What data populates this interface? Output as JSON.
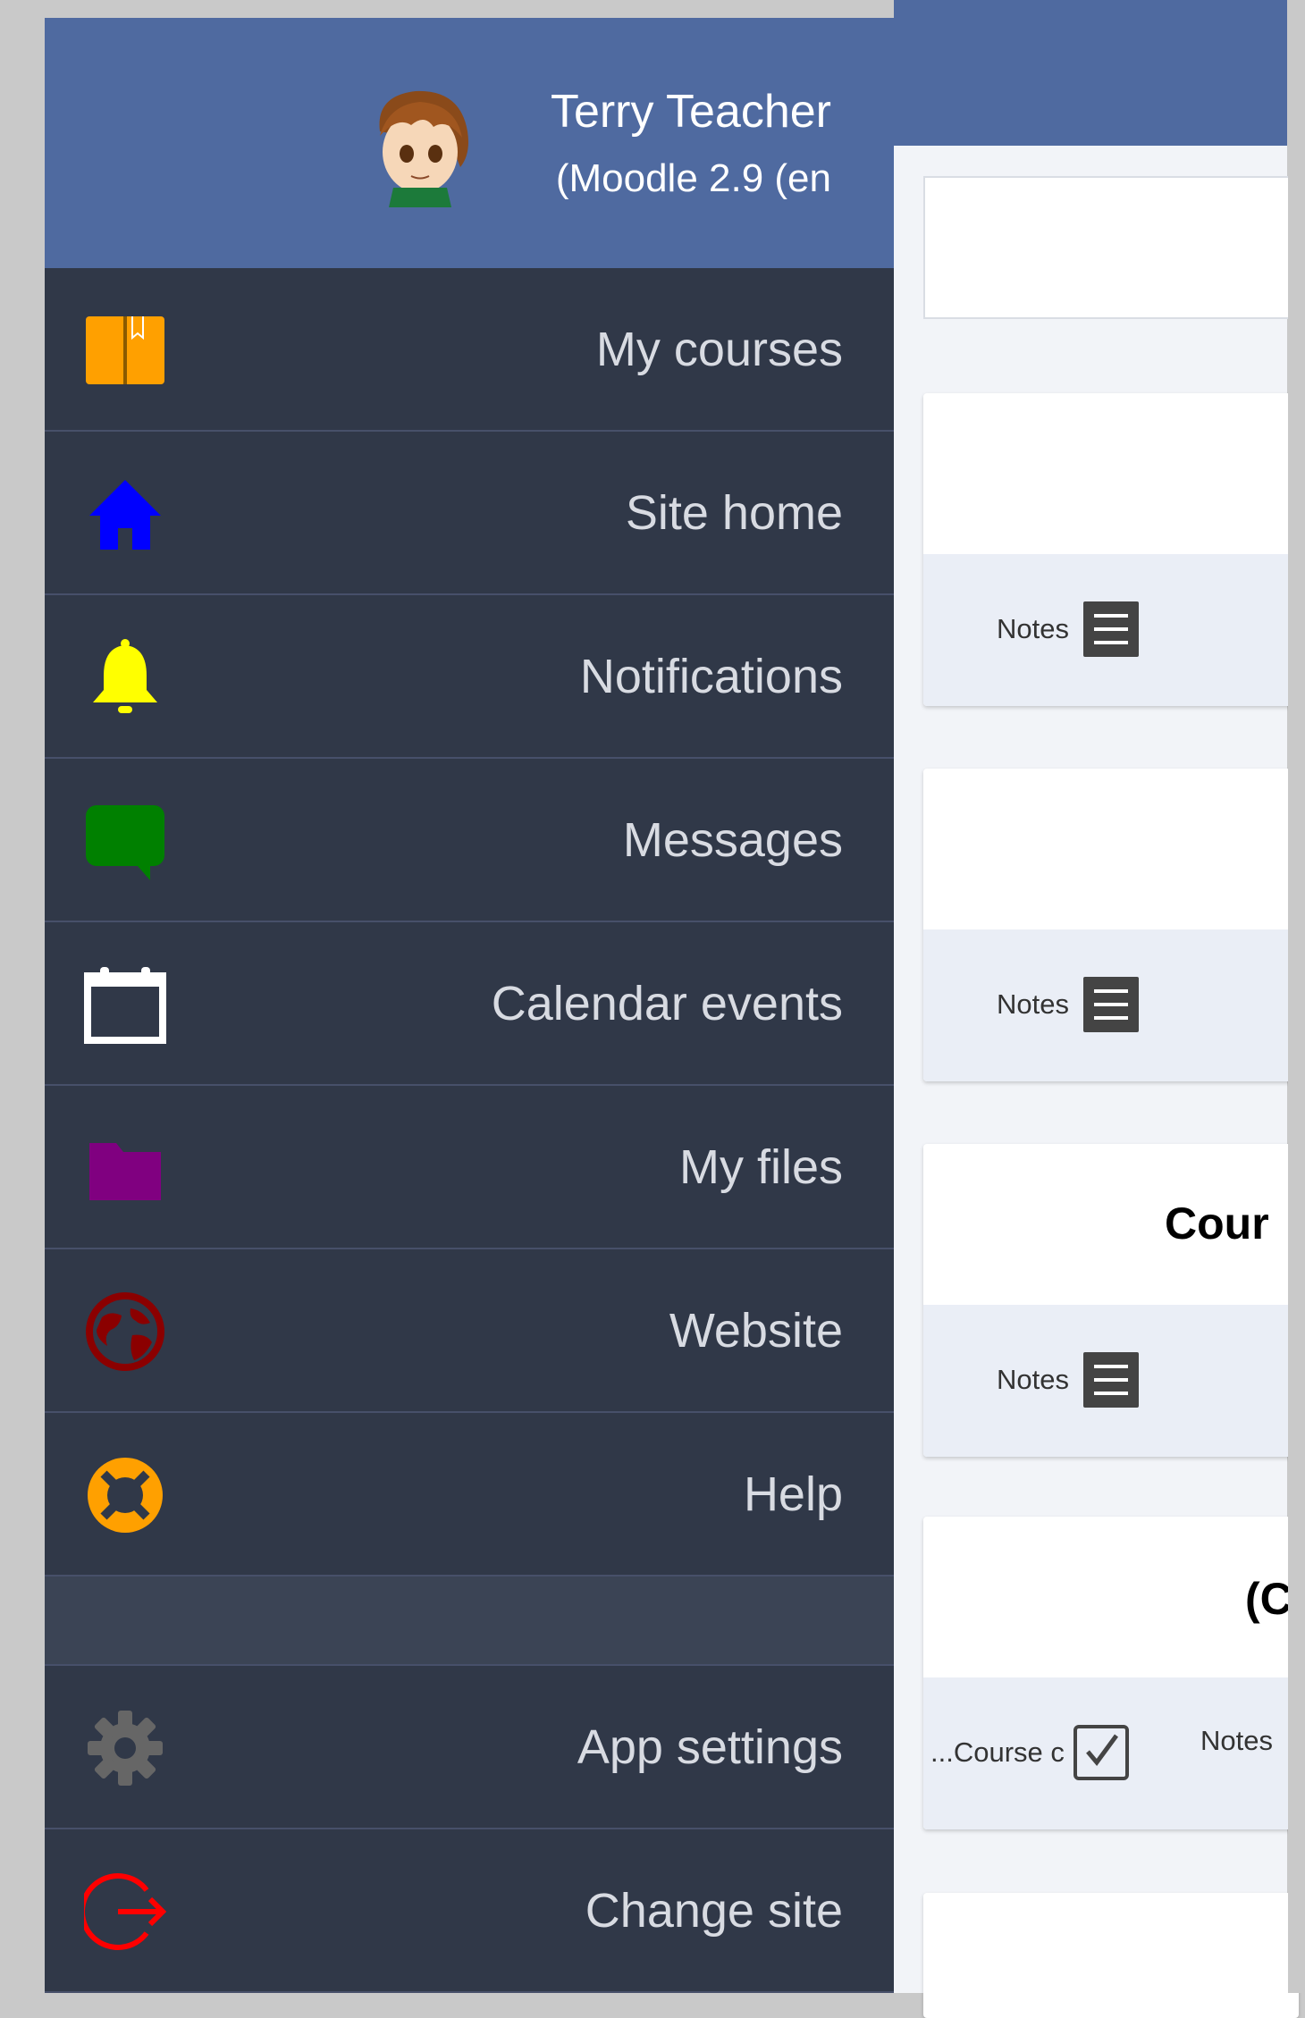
{
  "profile": {
    "name": "Terry Teacher",
    "site": "(Moodle 2.9 (en"
  },
  "menu": {
    "items": [
      {
        "label": "My courses",
        "icon": "book-icon",
        "color": "#ffa000"
      },
      {
        "label": "Site home",
        "icon": "home-icon",
        "color": "#0000ff"
      },
      {
        "label": "Notifications",
        "icon": "bell-icon",
        "color": "#ffff00"
      },
      {
        "label": "Messages",
        "icon": "chat-bubble-icon",
        "color": "#008000"
      },
      {
        "label": "Calendar events",
        "icon": "calendar-icon",
        "color": "#ffffff"
      },
      {
        "label": "My files",
        "icon": "folder-icon",
        "color": "#800080"
      },
      {
        "label": "Website",
        "icon": "globe-icon",
        "color": "#8b0000"
      },
      {
        "label": "Help",
        "icon": "lifebuoy-icon",
        "color": "#ffa000"
      }
    ],
    "bottom_items": [
      {
        "label": "App settings",
        "icon": "gear-icon",
        "color": "#666666"
      },
      {
        "label": "Change site",
        "icon": "logout-icon",
        "color": "#ff0000"
      }
    ]
  },
  "main": {
    "cards": [
      {
        "title": "",
        "footer": [
          {
            "label": "Notes",
            "icon": "list-icon"
          }
        ]
      },
      {
        "title": "",
        "footer": [
          {
            "label": "Notes",
            "icon": "list-icon"
          }
        ]
      },
      {
        "title": "Cour",
        "footer": [
          {
            "label": "Notes",
            "icon": "list-icon"
          }
        ]
      },
      {
        "title": "(C",
        "footer": [
          {
            "label": "...Course c",
            "icon": "checkbox-icon"
          },
          {
            "label": "Notes",
            "icon": "list-icon"
          }
        ]
      }
    ]
  }
}
